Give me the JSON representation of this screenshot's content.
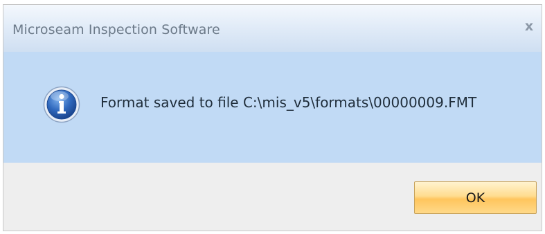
{
  "window": {
    "title": "Microseam Inspection Software",
    "close_glyph": "x"
  },
  "dialog": {
    "icon": "info-icon",
    "message": "Format saved to file C:\\mis_v5\\formats\\00000009.FMT"
  },
  "buttons": {
    "ok_label": "OK"
  },
  "colors": {
    "content_background": "#c1daf5",
    "button_accent": "#ffc55d",
    "icon_blue": "#2b5fae"
  }
}
